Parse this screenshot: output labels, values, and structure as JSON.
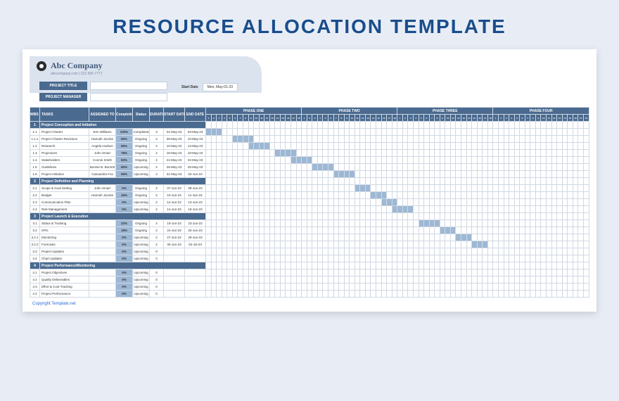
{
  "page_title": "RESOURCE ALLOCATION TEMPLATE",
  "company": {
    "name": "Abc Company",
    "sub": "abccompany.com | 222 555 7777",
    "logo_name": "circle-logo"
  },
  "fields": {
    "project_title_label": "PROJECT TITLE",
    "project_manager_label": "PROJECT MANAGER",
    "start_date_label": "Start Date",
    "start_date_value": "Mon, May-01-23"
  },
  "columns": {
    "wbs": "WBS NUMBER",
    "tasks": "TASKS",
    "assigned": "ASSIGNED TO",
    "completion": "Completion",
    "status": "Status",
    "duration": "DURATION",
    "start": "START DATE",
    "end": "END DATE"
  },
  "phases": [
    "PHASE ONE",
    "PHASE TWO",
    "PHASE THREE",
    "PHASE FOUR"
  ],
  "days_per_phase": 18,
  "rows": [
    {
      "type": "section",
      "wbs": "1",
      "task": "Project Conception and Initiation"
    },
    {
      "wbs": "1.1",
      "task": "Project Charter",
      "assn": "Erin Williams",
      "comp": "100%",
      "status": "Completed",
      "dur": "3",
      "sd": "01-May-23",
      "ed": "03-May-23",
      "bar": [
        0,
        3
      ]
    },
    {
      "wbs": "1.1.1",
      "task": "Project Charter Revisions",
      "assn": "Hannah Jacobs",
      "comp": "90%",
      "status": "Ongoing",
      "dur": "4",
      "sd": "08-May-23",
      "ed": "10-May-23",
      "bar": [
        5,
        4
      ]
    },
    {
      "wbs": "1.2",
      "task": "Research",
      "assn": "Angela Hudson",
      "comp": "65%",
      "status": "Ongoing",
      "dur": "4",
      "sd": "10-May-23",
      "ed": "13-May-23",
      "bar": [
        8,
        4
      ]
    },
    {
      "wbs": "1.3",
      "task": "Projections",
      "assn": "John Smart",
      "comp": "78%",
      "status": "Ongoing",
      "dur": "4",
      "sd": "16-May-23",
      "ed": "19-May-23",
      "bar": [
        13,
        4
      ]
    },
    {
      "wbs": "1.4",
      "task": "Stakeholders",
      "assn": "Connie Smith",
      "comp": "50%",
      "status": "Ongoing",
      "dur": "4",
      "sd": "21-May-23",
      "ed": "24-May-23",
      "bar": [
        16,
        4
      ]
    },
    {
      "wbs": "1.5",
      "task": "Guidelines",
      "assn": "Bonnie B. Burnett",
      "comp": "65%",
      "status": "Upcoming",
      "dur": "4",
      "sd": "26-May-23",
      "ed": "29-May-23",
      "bar": [
        20,
        4
      ]
    },
    {
      "wbs": "1.6",
      "task": "Project Initiation",
      "assn": "Cassandra Fox",
      "comp": "55%",
      "status": "Upcoming",
      "dur": "4",
      "sd": "31-May-23",
      "ed": "03-Jun-23",
      "bar": [
        24,
        4
      ]
    },
    {
      "type": "section",
      "wbs": "2",
      "task": "Project Definition and Planning"
    },
    {
      "wbs": "2.1",
      "task": "Scope & Goal Setting",
      "assn": "John Smart",
      "comp": "0%",
      "status": "Ongoing",
      "dur": "2",
      "sd": "07-Jun-23",
      "ed": "08-Jun-23",
      "bar": [
        28,
        3
      ]
    },
    {
      "wbs": "2.2",
      "task": "Budget",
      "assn": "Hannah Jacobs",
      "comp": "16%",
      "status": "Ongoing",
      "dur": "2",
      "sd": "10-Jun-23",
      "ed": "11-Jun-23",
      "bar": [
        31,
        3
      ]
    },
    {
      "wbs": "2.3",
      "task": "Communication Plan",
      "assn": "",
      "comp": "0%",
      "status": "Upcoming",
      "dur": "2",
      "sd": "12-Jun-23",
      "ed": "13-Jun-23",
      "bar": [
        33,
        3
      ]
    },
    {
      "wbs": "2.4",
      "task": "Risk Management",
      "assn": "",
      "comp": "0%",
      "status": "Upcoming",
      "dur": "2",
      "sd": "14-Jun-23",
      "ed": "18-Jun-23",
      "bar": [
        35,
        4
      ]
    },
    {
      "type": "section",
      "wbs": "3",
      "task": "Project Launch & Execution"
    },
    {
      "wbs": "3.1",
      "task": "Status & Tracking",
      "assn": "",
      "comp": "22%",
      "status": "Ongoing",
      "dur": "4",
      "sd": "19-Jun-23",
      "ed": "23-Jun-23",
      "bar": [
        40,
        4
      ]
    },
    {
      "wbs": "3.2",
      "task": "KPIs",
      "assn": "",
      "comp": "18%",
      "status": "Ongoing",
      "dur": "2",
      "sd": "24-Jun-23",
      "ed": "26-Jun-23",
      "bar": [
        44,
        3
      ]
    },
    {
      "wbs": "3.2.1",
      "task": "Monitoring",
      "assn": "",
      "comp": "0%",
      "status": "Upcoming",
      "dur": "2",
      "sd": "27-Jun-23",
      "ed": "29-Jun-23",
      "bar": [
        47,
        3
      ]
    },
    {
      "wbs": "3.2.2",
      "task": "Forecasts",
      "assn": "",
      "comp": "0%",
      "status": "Upcoming",
      "dur": "2",
      "sd": "30-Jun-23",
      "ed": "02-Jul-23",
      "bar": [
        50,
        3
      ]
    },
    {
      "wbs": "3.3",
      "task": "Project Updates",
      "assn": "",
      "comp": "0%",
      "status": "Upcoming",
      "dur": "0",
      "sd": "",
      "ed": ""
    },
    {
      "wbs": "3.4",
      "task": "Chart Updates",
      "assn": "",
      "comp": "0%",
      "status": "Upcoming",
      "dur": "0",
      "sd": "",
      "ed": ""
    },
    {
      "type": "section",
      "wbs": "4",
      "task": "Project Performance/Monitoring"
    },
    {
      "wbs": "4.1",
      "task": "Project Objectives",
      "assn": "",
      "comp": "0%",
      "status": "Upcoming",
      "dur": "0",
      "sd": "",
      "ed": ""
    },
    {
      "wbs": "4.2",
      "task": "Quality Deliverables",
      "assn": "",
      "comp": "0%",
      "status": "Upcoming",
      "dur": "0",
      "sd": "",
      "ed": ""
    },
    {
      "wbs": "4.3",
      "task": "Effort & Cost Tracking",
      "assn": "",
      "comp": "0%",
      "status": "Upcoming",
      "dur": "0",
      "sd": "",
      "ed": ""
    },
    {
      "wbs": "4.4",
      "task": "Project Performance",
      "assn": "",
      "comp": "0%",
      "status": "Upcoming",
      "dur": "0",
      "sd": "",
      "ed": ""
    }
  ],
  "copyright": "Copyright Template.net"
}
